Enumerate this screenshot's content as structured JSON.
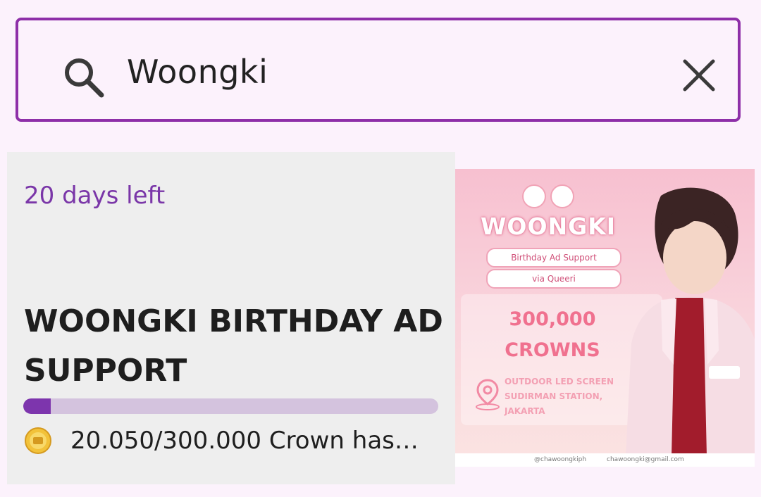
{
  "search": {
    "query": "Woongki"
  },
  "card": {
    "days_left": "20 days left",
    "title": "WOONGKI BIRTHDAY AD SUPPORT",
    "progress_text": "20.050/300.000 Crown has…",
    "progress_fraction": 0.0668
  },
  "banner": {
    "name": "WOONGKI",
    "subtitle": "Birthday Ad Support",
    "via": "via Queeri",
    "amount": "300,000",
    "unit": "CROWNS",
    "location": "OUTDOOR LED SCREEN SUDIRMAN STATION, JAKARTA",
    "twitter": "@chawoongkiph",
    "email": "chawoongki@gmail.com"
  },
  "colors": {
    "accent": "#8e2fa8",
    "progress": "#7d35ad",
    "track": "#d4c3de"
  }
}
